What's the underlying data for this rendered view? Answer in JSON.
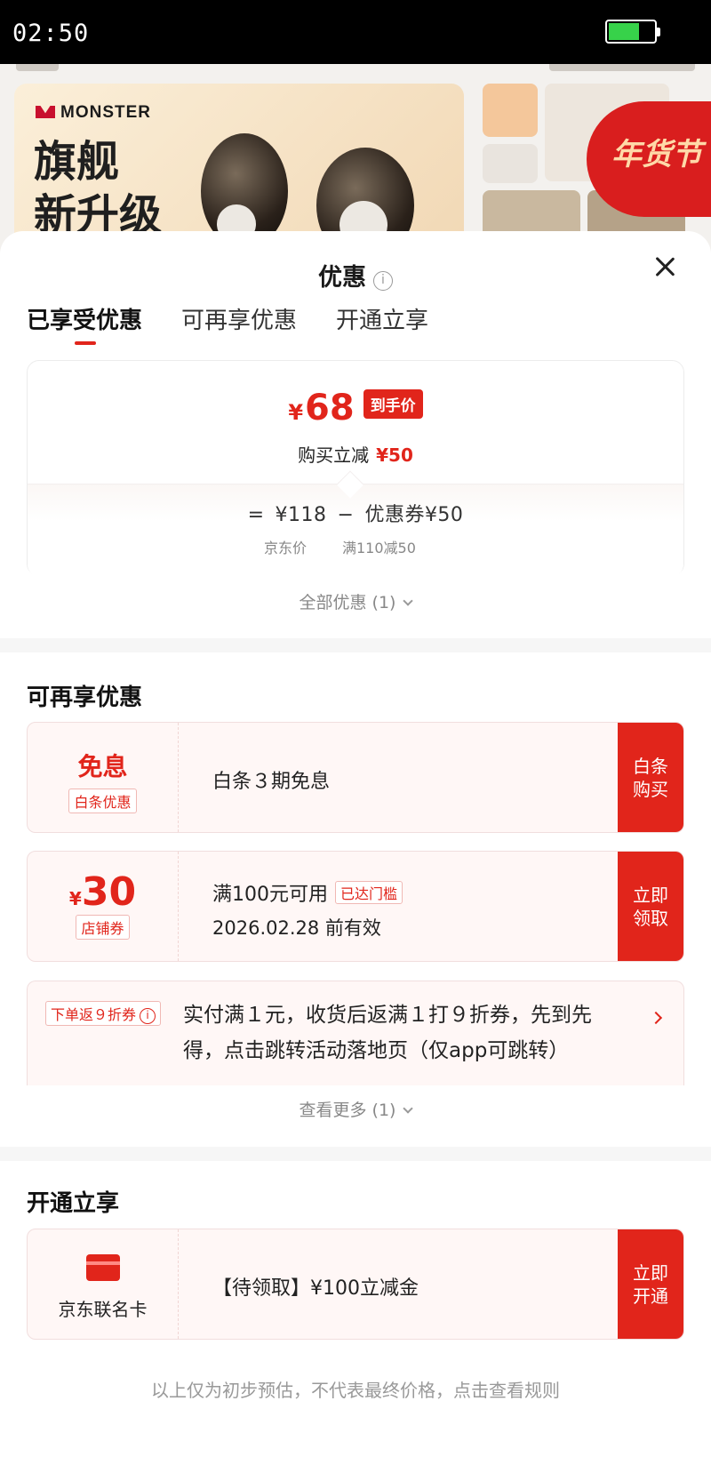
{
  "status_bar": {
    "time": "02:50"
  },
  "background": {
    "brand": "MONSTER",
    "headline_1": "旗舰",
    "headline_2": "新升级",
    "promo": "年货节"
  },
  "sheet": {
    "title": "优惠",
    "tabs": [
      {
        "label": "已享受优惠",
        "active": true
      },
      {
        "label": "可再享优惠",
        "active": false
      },
      {
        "label": "开通立享",
        "active": false
      }
    ]
  },
  "price_card": {
    "currency": "¥",
    "final_price": "68",
    "final_badge": "到手价",
    "discount_label": "购买立减",
    "discount_amount": "¥50",
    "formula": {
      "equals": "=",
      "base_price": "¥118",
      "minus": "−",
      "coupon": "优惠券¥50"
    },
    "base_price_label": "京东价",
    "coupon_condition": "满110减50"
  },
  "all_offers": "全部优惠 (1)",
  "more_offers": {
    "title": "可再享优惠",
    "items": [
      {
        "left_title": "免息",
        "left_tag": "白条优惠",
        "text": "白条３期免息",
        "cta": "白条\n购买"
      },
      {
        "left_currency": "¥",
        "left_amount": "30",
        "left_tag": "店铺券",
        "line1": "满100元可用",
        "met_tag": "已达门槛",
        "line2": "2026.02.28 前有效",
        "cta": "立即\n领取"
      }
    ],
    "return_coupon": {
      "tag": "下单返９折券",
      "text": "实付满１元，收货后返满１打９折券，先到先得，点击跳转活动落地页（仅app可跳转）"
    },
    "see_more": "查看更多 (1)"
  },
  "open_now": {
    "title": "开通立享",
    "item": {
      "left_label": "京东联名卡",
      "text": "【待领取】¥100立减金",
      "cta": "立即\n开通"
    }
  },
  "footnote": "以上仅为初步预估，不代表最终价格，点击查看规则",
  "colors": {
    "accent": "#e1251b",
    "card_bg": "#fff7f6",
    "battery": "#37d24a"
  }
}
